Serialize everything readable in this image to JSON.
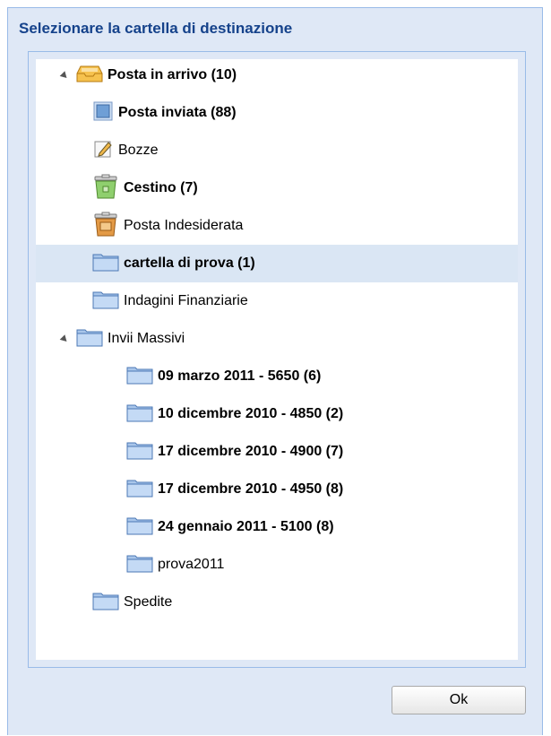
{
  "dialog": {
    "title": "Selezionare la cartella di destinazione",
    "ok_label": "Ok"
  },
  "tree": {
    "items": [
      {
        "label": "Posta in arrivo (10)",
        "bold": true,
        "icon": "inbox-icon",
        "expanded": true
      },
      {
        "label": "Posta inviata (88)",
        "bold": true,
        "icon": "sent-icon"
      },
      {
        "label": "Bozze",
        "bold": false,
        "icon": "drafts-icon"
      },
      {
        "label": "Cestino (7)",
        "bold": true,
        "icon": "trash-icon"
      },
      {
        "label": "Posta Indesiderata",
        "bold": false,
        "icon": "junk-icon"
      },
      {
        "label": "cartella di prova (1)",
        "bold": true,
        "icon": "folder-icon",
        "selected": true
      },
      {
        "label": "Indagini Finanziarie",
        "bold": false,
        "icon": "folder-icon"
      },
      {
        "label": "Invii Massivi",
        "bold": false,
        "icon": "folder-icon",
        "expanded": true
      },
      {
        "label": "09 marzo 2011 - 5650 (6)",
        "bold": true,
        "icon": "folder-icon"
      },
      {
        "label": "10 dicembre 2010 - 4850 (2)",
        "bold": true,
        "icon": "folder-icon"
      },
      {
        "label": "17 dicembre 2010 - 4900 (7)",
        "bold": true,
        "icon": "folder-icon"
      },
      {
        "label": "17 dicembre 2010 - 4950 (8)",
        "bold": true,
        "icon": "folder-icon"
      },
      {
        "label": "24 gennaio 2011 - 5100 (8)",
        "bold": true,
        "icon": "folder-icon"
      },
      {
        "label": "prova2011",
        "bold": false,
        "icon": "folder-icon"
      },
      {
        "label": "Spedite",
        "bold": false,
        "icon": "folder-icon"
      }
    ]
  }
}
